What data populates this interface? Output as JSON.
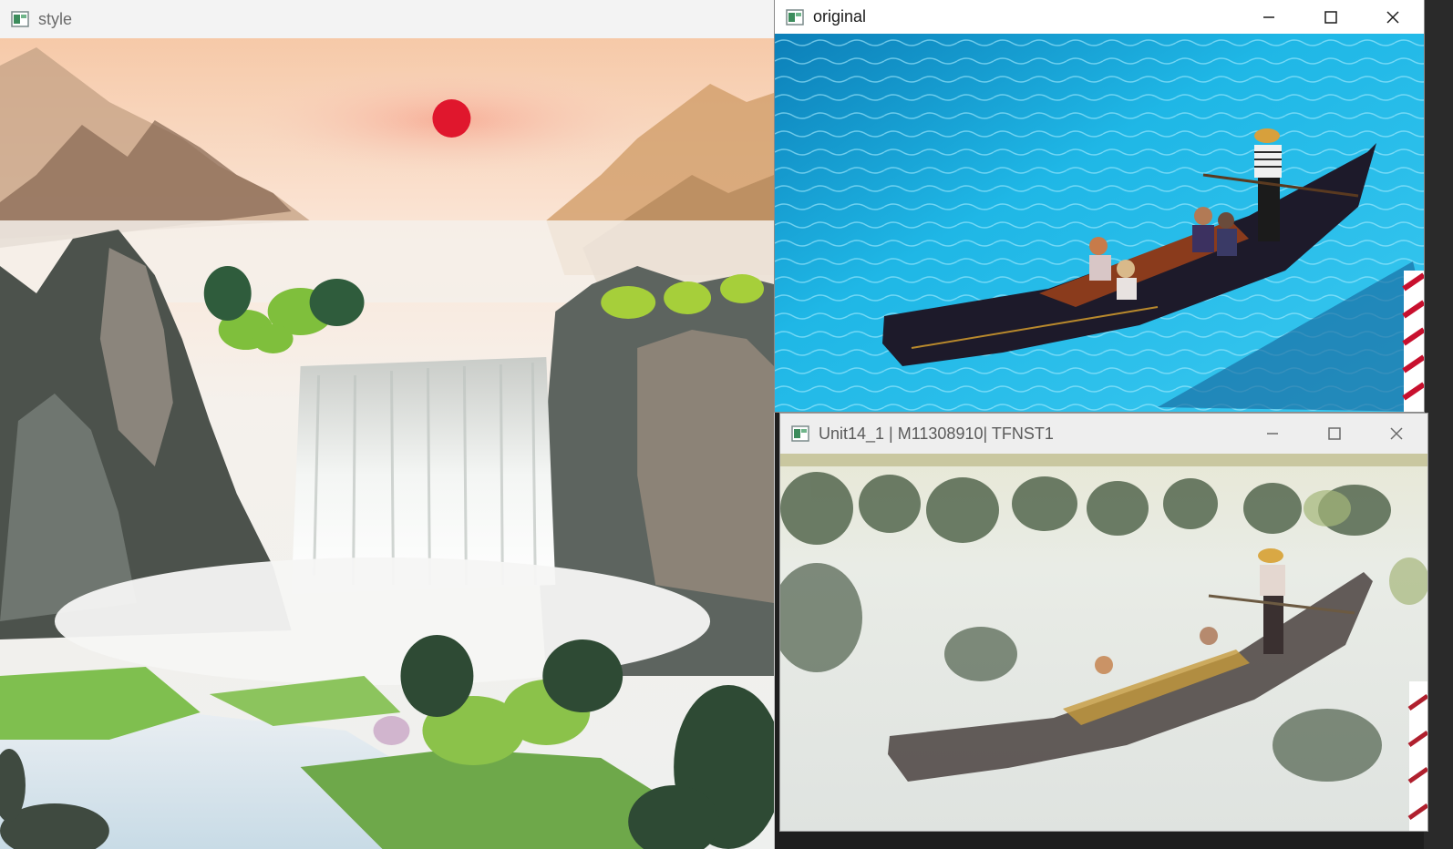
{
  "windows": {
    "style": {
      "title": "style",
      "image_alt": "Chinese landscape painting with red sun, misty mountains and a waterfall"
    },
    "original": {
      "title": "original",
      "image_alt": "Gondola with passengers on bright turquoise water"
    },
    "result": {
      "title": "Unit14_1 | M11308910| TFNST1",
      "image_alt": "Stylized gondola rendered in the landscape painting style"
    }
  },
  "icons": {
    "app": "app-window-icon",
    "minimize": "minimize-icon",
    "maximize": "maximize-icon",
    "close": "close-icon"
  },
  "colors": {
    "titlebar_active": "#ffffff",
    "titlebar_inactive": "#f3f3f3",
    "water": "#1fb7e6",
    "sun": "#e0172d"
  }
}
